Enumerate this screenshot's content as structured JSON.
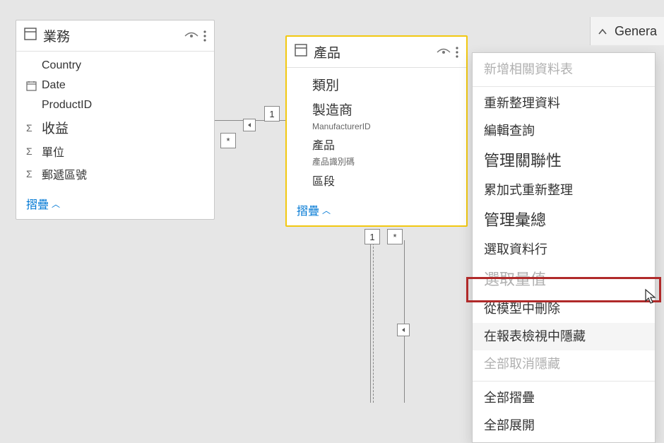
{
  "tables": {
    "sales": {
      "title": "業務",
      "fields": {
        "country": "Country",
        "date": "Date",
        "productId": "ProductID",
        "revenue": "收益",
        "units": "單位",
        "zip": "郵遞區號"
      },
      "collapse": "摺疊"
    },
    "product": {
      "title": "產品",
      "fields": {
        "category": "類別",
        "manufacturer": "製造商",
        "manufacturerId": "ManufacturerID",
        "product": "產品",
        "productCode": "產品識別碼",
        "segment": "區段"
      },
      "collapse": "摺疊"
    }
  },
  "relationship": {
    "left_many": "*",
    "right_one": "1",
    "bottom_one": "1",
    "bottom_many": "*"
  },
  "pane": {
    "general": "Genera"
  },
  "menu": {
    "addRelated": "新增相關資料表",
    "refreshData": "重新整理資料",
    "editQuery": "編輯查詢",
    "manageRel": "管理關聯性",
    "incRefresh": "累加式重新整理",
    "manageAgg": "管理彙總",
    "selectCols": "選取資料行",
    "selectMeas": "選取量值",
    "deleteModel": "從模型中刪除",
    "hideReport": "在報表檢視中隱藏",
    "unhideAll": "全部取消隱藏",
    "collapseAll": "全部摺疊",
    "expandAll": "全部展開"
  }
}
